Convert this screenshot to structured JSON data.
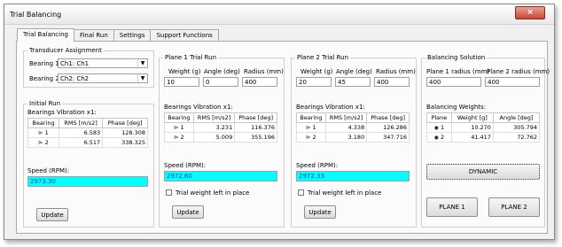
{
  "window": {
    "title": "Trial Balancing",
    "close_glyph": "×"
  },
  "tabs": [
    {
      "label": "Trial Balancing",
      "active": true
    },
    {
      "label": "Final Run"
    },
    {
      "label": "Settings"
    },
    {
      "label": "Support Functions"
    }
  ],
  "transducer": {
    "legend": "Transducer Assignment",
    "bearing1_label": "Bearing 1:",
    "bearing1_value": "Ch1: Ch1",
    "bearing2_label": "Bearing 2:",
    "bearing2_value": "Ch2: Ch2"
  },
  "initial_run": {
    "legend": "Initial Run",
    "vib_label": "Bearings Vibration x1:",
    "headers": [
      "Bearing",
      "RMS [m/s2]",
      "Phase [deg]"
    ],
    "rows": [
      {
        "bearing": "1",
        "rms": "6.583",
        "phase": "128.308"
      },
      {
        "bearing": "2",
        "rms": "6.517",
        "phase": "338.325"
      }
    ],
    "speed_label": "Speed (RPM):",
    "speed_value": "2973.30",
    "update_label": "Update"
  },
  "plane1": {
    "legend": "Plane 1 Trial Run",
    "weight_label": "Weight (g)",
    "angle_label": "Angle (deg)",
    "radius_label": "Radius (mm)",
    "weight": "10",
    "angle": "0",
    "radius": "400",
    "vib_label": "Bearings Vibration x1:",
    "headers": [
      "Bearing",
      "RMS [m/s2]",
      "Phase [deg]"
    ],
    "rows": [
      {
        "bearing": "1",
        "rms": "3.231",
        "phase": "116.376"
      },
      {
        "bearing": "2",
        "rms": "5.009",
        "phase": "355.196"
      }
    ],
    "speed_label": "Speed (RPM):",
    "speed_value": "2972.60",
    "trial_weight_label": "Trial weight left in place",
    "update_label": "Update"
  },
  "plane2": {
    "legend": "Plane 2 Trial Run",
    "weight_label": "Weight (g)",
    "angle_label": "Angle (deg)",
    "radius_label": "Radius (mm)",
    "weight": "20",
    "angle": "45",
    "radius": "400",
    "vib_label": "Bearings Vibration x1:",
    "headers": [
      "Bearing",
      "RMS [m/s2]",
      "Phase [deg]"
    ],
    "rows": [
      {
        "bearing": "1",
        "rms": "4.338",
        "phase": "126.286"
      },
      {
        "bearing": "2",
        "rms": "3.180",
        "phase": "347.716"
      }
    ],
    "speed_label": "Speed (RPM):",
    "speed_value": "2972.33",
    "trial_weight_label": "Trial weight left in place",
    "update_label": "Update"
  },
  "solution": {
    "legend": "Balancing Solution",
    "plane1_radius_label": "Plane 1 radius (mm)",
    "plane2_radius_label": "Plane 2 radius (mm)",
    "plane1_radius": "400",
    "plane2_radius": "400",
    "weights_label": "Balancing Weights:",
    "headers": [
      "Plane",
      "Weight [g]",
      "Angle [deg]"
    ],
    "rows": [
      {
        "plane": "1",
        "weight": "10.270",
        "angle": "305.794"
      },
      {
        "plane": "2",
        "weight": "41.417",
        "angle": "72.762"
      }
    ],
    "dynamic_label": "DYNAMIC",
    "plane1_button": "PLANE 1",
    "plane2_button": "PLANE 2"
  },
  "colors": {
    "speed_bg": "#00ffff",
    "close_button": "#c74634"
  }
}
